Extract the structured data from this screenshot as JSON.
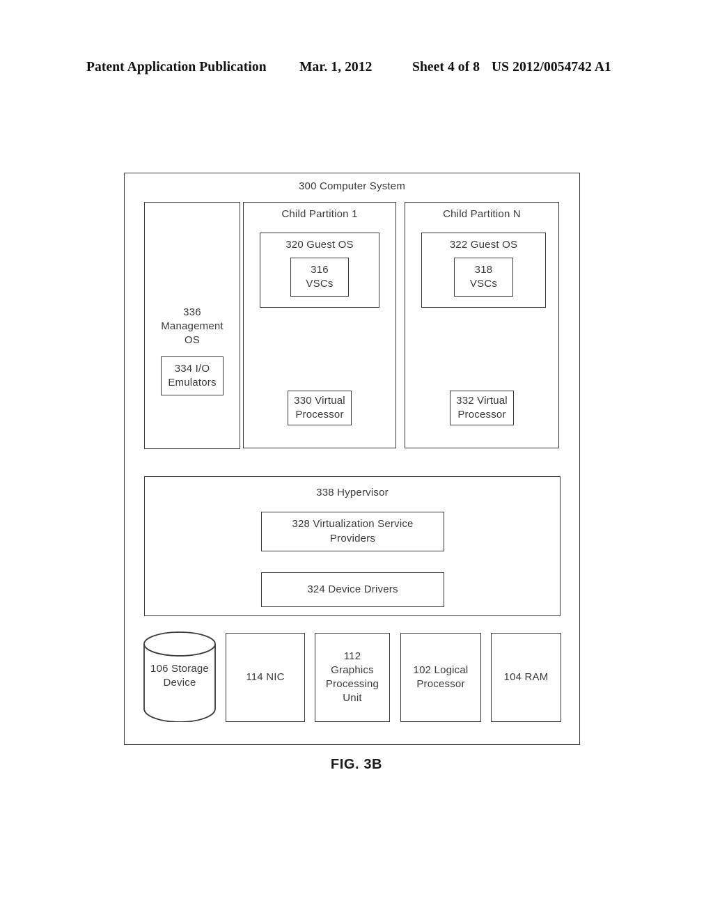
{
  "header": {
    "publication": "Patent Application Publication",
    "date": "Mar. 1, 2012",
    "sheet": "Sheet 4 of 8",
    "patent_number": "US 2012/0054742 A1"
  },
  "figure": {
    "caption": "FIG. 3B"
  },
  "diagram": {
    "computer_system": {
      "title": "300 Computer System"
    },
    "management_os": {
      "title": "336\nManagement\nOS",
      "io_emulators": "334 I/O\nEmulators"
    },
    "child_partition_1": {
      "title": "Child Partition 1",
      "guest_os": "320 Guest OS",
      "vscs": "316\nVSCs",
      "virtual_processor": "330 Virtual\nProcessor"
    },
    "child_partition_n": {
      "title": "Child Partition N",
      "guest_os": "322 Guest OS",
      "vscs": "318\nVSCs",
      "virtual_processor": "332 Virtual\nProcessor"
    },
    "hypervisor": {
      "title": "338 Hypervisor",
      "virtualization_service_providers": "328 Virtualization Service\nProviders",
      "device_drivers": "324 Device Drivers"
    },
    "hardware": {
      "storage_device": "106 Storage\nDevice",
      "nic": "114 NIC",
      "gpu": "112\nGraphics\nProcessing\nUnit",
      "logical_processor": "102 Logical\nProcessor",
      "ram": "104 RAM"
    }
  }
}
